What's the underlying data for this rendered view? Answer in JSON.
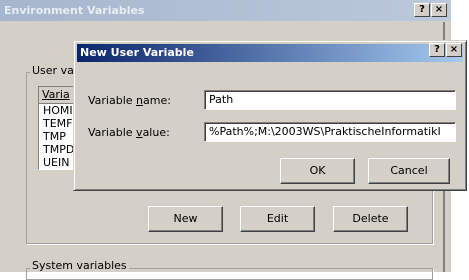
{
  "env_dialog": {
    "title": "Environment Variables",
    "help_btn": "?",
    "close_btn": "×",
    "user_group_label": "User va",
    "list_header": "Varia",
    "user_vars": [
      "HOMI",
      "TEMF",
      "TMP",
      "TMPD",
      "UEIN"
    ],
    "buttons": {
      "new": "New",
      "edit": "Edit",
      "delete": "Delete"
    },
    "system_group_label": "System variables"
  },
  "new_var_dialog": {
    "title": "New User Variable",
    "help_btn": "?",
    "close_btn": "×",
    "name_label_pre": "Variable ",
    "name_label_hotkey": "n",
    "name_label_post": "ame:",
    "value_label_pre": "Variable ",
    "value_label_hotkey": "v",
    "value_label_post": "alue:",
    "name_value": "Path",
    "value_value": "%Path%;M:\\2003WS\\PraktischeInformatikI",
    "ok_label": "OK",
    "cancel_label": "Cancel"
  }
}
